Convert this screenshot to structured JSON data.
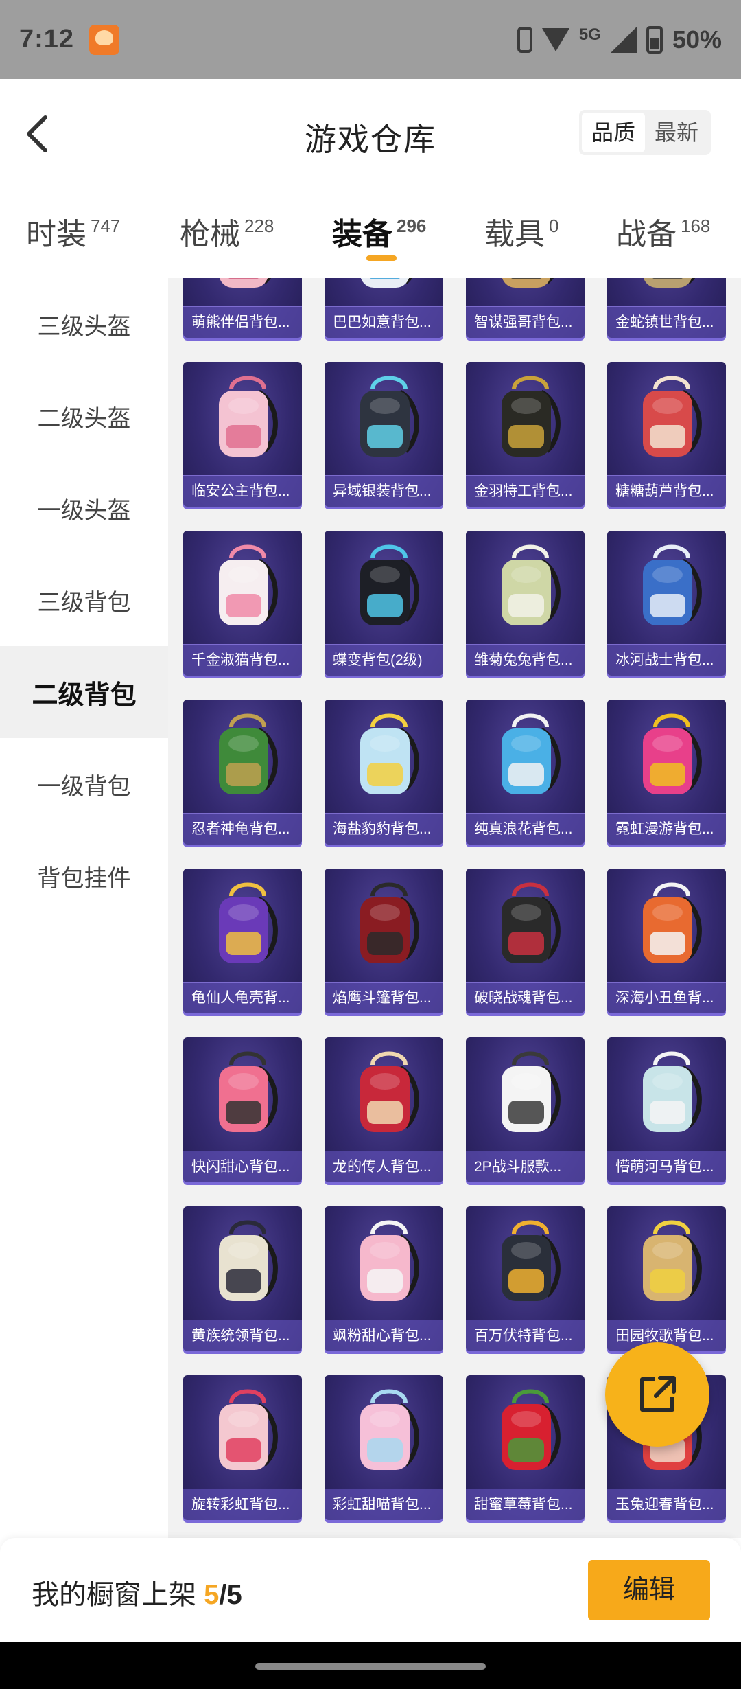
{
  "status_bar": {
    "time": "7:12",
    "network": "5G",
    "battery": "50%"
  },
  "header": {
    "title": "游戏仓库",
    "sort_options": [
      "品质",
      "最新"
    ],
    "active_sort": 0
  },
  "tabs": [
    {
      "label": "时装",
      "count": "747"
    },
    {
      "label": "枪械",
      "count": "228"
    },
    {
      "label": "装备",
      "count": "296"
    },
    {
      "label": "载具",
      "count": "0"
    },
    {
      "label": "战备",
      "count": "168"
    }
  ],
  "active_tab": 2,
  "side_menu": [
    "三级头盔",
    "二级头盔",
    "一级头盔",
    "三级背包",
    "二级背包",
    "一级背包",
    "背包挂件"
  ],
  "active_side": 4,
  "items": [
    {
      "name": "萌熊伴侣背包...",
      "color": "#f2b8c6",
      "accent": "#d06080"
    },
    {
      "name": "巴巴如意背包...",
      "color": "#e9eef5",
      "accent": "#3aa0d8"
    },
    {
      "name": "智谋强哥背包...",
      "color": "#c8a060",
      "accent": "#3a3a3a"
    },
    {
      "name": "金蛇镇世背包...",
      "color": "#b8a070",
      "accent": "#444444"
    },
    {
      "name": "临安公主背包...",
      "color": "#f4c3d2",
      "accent": "#e07090"
    },
    {
      "name": "异域银装背包...",
      "color": "#2e3440",
      "accent": "#5fd0e8"
    },
    {
      "name": "金羽特工背包...",
      "color": "#2a2a24",
      "accent": "#c9a23a"
    },
    {
      "name": "糖糖葫芦背包...",
      "color": "#d84a4a",
      "accent": "#f3e3d0"
    },
    {
      "name": "千金淑猫背包...",
      "color": "#f6eef0",
      "accent": "#f08aa8"
    },
    {
      "name": "蝶变背包(2级)",
      "color": "#1d1f26",
      "accent": "#4fc6e8"
    },
    {
      "name": "雏菊兔兔背包...",
      "color": "#cfd7a6",
      "accent": "#f2f2e8"
    },
    {
      "name": "冰河战士背包...",
      "color": "#3a6fc8",
      "accent": "#e8eef8"
    },
    {
      "name": "忍者神龟背包...",
      "color": "#3f8a3a",
      "accent": "#c0a050"
    },
    {
      "name": "海盐豹豹背包...",
      "color": "#bfe3f3",
      "accent": "#f3d040"
    },
    {
      "name": "纯真浪花背包...",
      "color": "#4ab0e6",
      "accent": "#f2f2f2"
    },
    {
      "name": "霓虹漫游背包...",
      "color": "#e8408a",
      "accent": "#f0c020"
    },
    {
      "name": "龟仙人龟壳背...",
      "color": "#6a3ab8",
      "accent": "#f0c040"
    },
    {
      "name": "焰鹰斗篷背包...",
      "color": "#8a1c22",
      "accent": "#2a2a2a"
    },
    {
      "name": "破晓战魂背包...",
      "color": "#2a2a2a",
      "accent": "#c83040"
    },
    {
      "name": "深海小丑鱼背...",
      "color": "#e86a30",
      "accent": "#f4f4f4"
    },
    {
      "name": "快闪甜心背包...",
      "color": "#f07090",
      "accent": "#333333"
    },
    {
      "name": "龙的传人背包...",
      "color": "#c8283a",
      "accent": "#f0d8b0"
    },
    {
      "name": "2P战斗服款...",
      "color": "#f4f4f4",
      "accent": "#3a3a3a"
    },
    {
      "name": "懵萌河马背包...",
      "color": "#c8e4e8",
      "accent": "#f4f4f4"
    },
    {
      "name": "黄族统领背包...",
      "color": "#e8e2d0",
      "accent": "#2a2a3a"
    },
    {
      "name": "飒粉甜心背包...",
      "color": "#f6b8cc",
      "accent": "#f4f4f4"
    },
    {
      "name": "百万伏特背包...",
      "color": "#2a2f3a",
      "accent": "#f0b030"
    },
    {
      "name": "田园牧歌背包...",
      "color": "#d8b470",
      "accent": "#f0d040"
    },
    {
      "name": "旋转彩虹背包...",
      "color": "#f4c8d0",
      "accent": "#e04060"
    },
    {
      "name": "彩虹甜喵背包...",
      "color": "#f6c0d8",
      "accent": "#a8d8f0"
    },
    {
      "name": "甜蜜草莓背包...",
      "color": "#d82030",
      "accent": "#4a9a3a"
    },
    {
      "name": "玉兔迎春背包...",
      "color": "#e04040",
      "accent": "#f0d8c8"
    }
  ],
  "shelf": {
    "label": "我的橱窗上架 ",
    "count": "5",
    "total": "/5"
  },
  "edit_label": "编辑"
}
